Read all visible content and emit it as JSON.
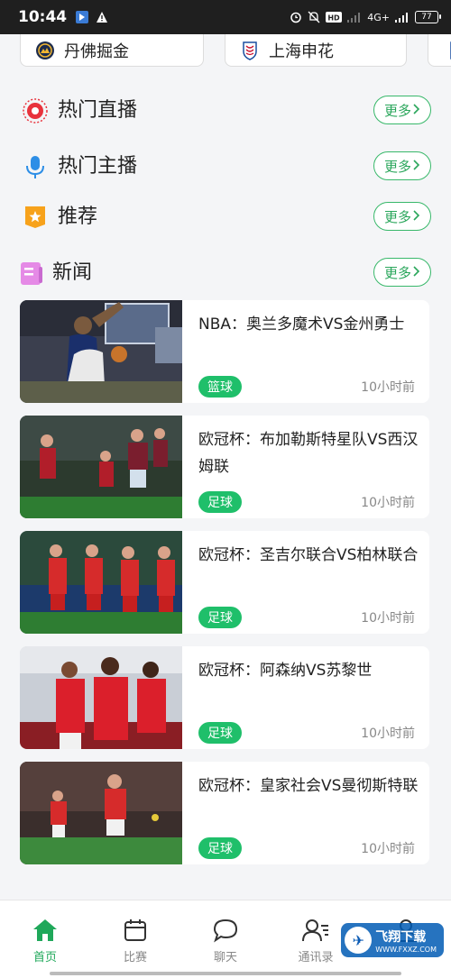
{
  "status_bar": {
    "time": "10:44",
    "right_text": "4G+",
    "battery": "77"
  },
  "teams": [
    {
      "name": "丹佛掘金"
    },
    {
      "name": "上海申花"
    }
  ],
  "sections": {
    "hot_live": {
      "title": "热门直播",
      "more": "更多"
    },
    "hot_anchor": {
      "title": "热门主播",
      "more": "更多"
    },
    "recommend": {
      "title": "推荐",
      "more": "更多"
    },
    "news": {
      "title": "新闻",
      "more": "更多"
    }
  },
  "news": [
    {
      "title": "NBA：奥兰多魔术VS金州勇士",
      "tag": "篮球",
      "time": "10小时前"
    },
    {
      "title": "欧冠杯：布加勒斯特星队VS西汉姆联",
      "tag": "足球",
      "time": "10小时前"
    },
    {
      "title": "欧冠杯：圣吉尔联合VS柏林联合",
      "tag": "足球",
      "time": "10小时前"
    },
    {
      "title": "欧冠杯：阿森纳VS苏黎世",
      "tag": "足球",
      "time": "10小时前"
    },
    {
      "title": "欧冠杯：皇家社会VS曼彻斯特联",
      "tag": "足球",
      "time": "10小时前"
    }
  ],
  "bottom_nav": [
    {
      "label": "首页",
      "icon": "home-icon",
      "active": true
    },
    {
      "label": "比赛",
      "icon": "calendar-icon",
      "active": false
    },
    {
      "label": "聊天",
      "icon": "chat-icon",
      "active": false
    },
    {
      "label": "通讯录",
      "icon": "contacts-icon",
      "active": false
    },
    {
      "label": "",
      "icon": "profile-icon",
      "active": false
    }
  ],
  "watermark": {
    "title": "飞翔下载",
    "sub": "WWW.FXXZ.COM"
  },
  "colors": {
    "accent": "#1fbf6a",
    "status_bar": "#1f1f1f",
    "background": "#f4f5f7"
  }
}
